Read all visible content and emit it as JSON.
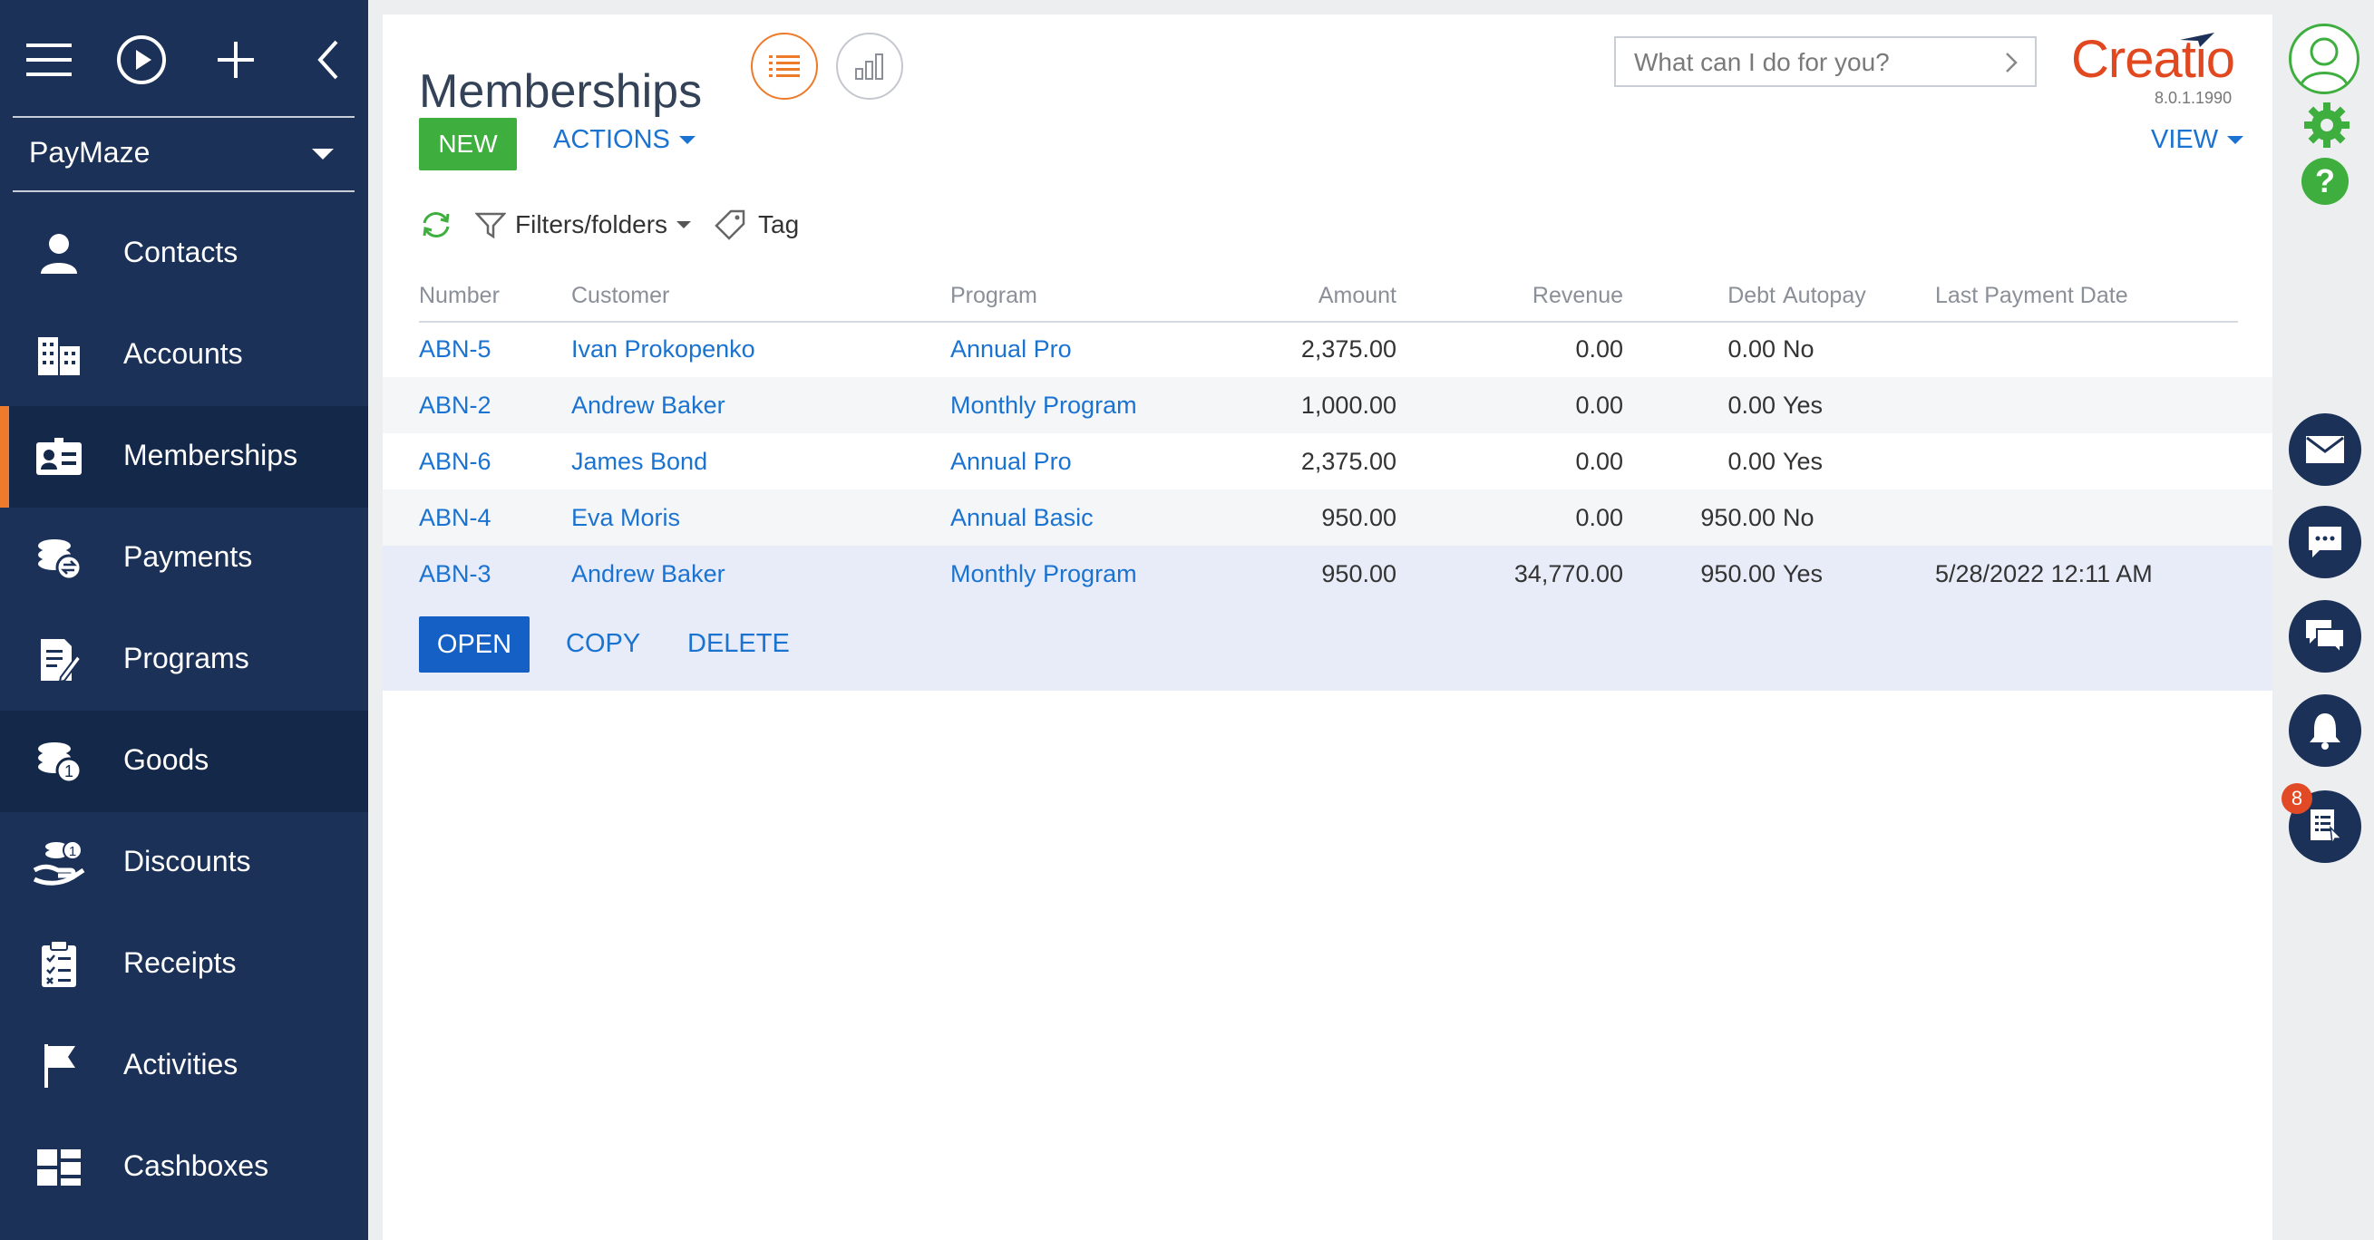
{
  "app": {
    "workspace": "PayMaze",
    "logo_text": "Creatio",
    "version": "8.0.1.1990"
  },
  "sidebar": {
    "items": [
      {
        "label": "Contacts",
        "icon": "contact-icon"
      },
      {
        "label": "Accounts",
        "icon": "building-icon"
      },
      {
        "label": "Memberships",
        "icon": "id-card-icon",
        "active": true
      },
      {
        "label": "Payments",
        "icon": "coins-exchange-icon"
      },
      {
        "label": "Programs",
        "icon": "document-edit-icon"
      },
      {
        "label": "Goods",
        "icon": "coins-one-icon"
      },
      {
        "label": "Discounts",
        "icon": "hand-coins-icon"
      },
      {
        "label": "Receipts",
        "icon": "clipboard-list-icon"
      },
      {
        "label": "Activities",
        "icon": "flag-icon"
      },
      {
        "label": "Cashboxes",
        "icon": "blocks-icon"
      }
    ]
  },
  "page": {
    "title": "Memberships",
    "search_placeholder": "What can I do for you?",
    "new_label": "NEW",
    "actions_label": "ACTIONS",
    "view_label": "VIEW",
    "filters_label": "Filters/folders",
    "tag_label": "Tag"
  },
  "grid": {
    "columns": [
      "Number",
      "Customer",
      "Program",
      "Amount",
      "Revenue",
      "Debt",
      "Autopay",
      "Last Payment Date"
    ],
    "rows": [
      {
        "number": "ABN-5",
        "customer": "Ivan Prokopenko",
        "program": "Annual Pro",
        "amount": "2,375.00",
        "revenue": "0.00",
        "debt": "0.00",
        "autopay": "No",
        "last_payment": ""
      },
      {
        "number": "ABN-2",
        "customer": "Andrew Baker",
        "program": "Monthly Program",
        "amount": "1,000.00",
        "revenue": "0.00",
        "debt": "0.00",
        "autopay": "Yes",
        "last_payment": ""
      },
      {
        "number": "ABN-6",
        "customer": "James Bond",
        "program": "Annual Pro",
        "amount": "2,375.00",
        "revenue": "0.00",
        "debt": "0.00",
        "autopay": "Yes",
        "last_payment": ""
      },
      {
        "number": "ABN-4",
        "customer": "Eva Moris",
        "program": "Annual Basic",
        "amount": "950.00",
        "revenue": "0.00",
        "debt": "950.00",
        "autopay": "No",
        "last_payment": ""
      },
      {
        "number": "ABN-3",
        "customer": "Andrew Baker",
        "program": "Monthly Program",
        "amount": "950.00",
        "revenue": "34,770.00",
        "debt": "950.00",
        "autopay": "Yes",
        "last_payment": "5/28/2022 12:11 AM"
      }
    ],
    "row_actions": {
      "open": "OPEN",
      "copy": "COPY",
      "delete": "DELETE"
    }
  },
  "rail": {
    "notification_count": "8"
  },
  "colors": {
    "sidebar": "#1b3158",
    "accent_orange": "#ee7a2c",
    "link_blue": "#1b73d1",
    "new_green": "#3eae3e",
    "open_blue": "#1560c4",
    "logo_red": "#e2481f"
  }
}
